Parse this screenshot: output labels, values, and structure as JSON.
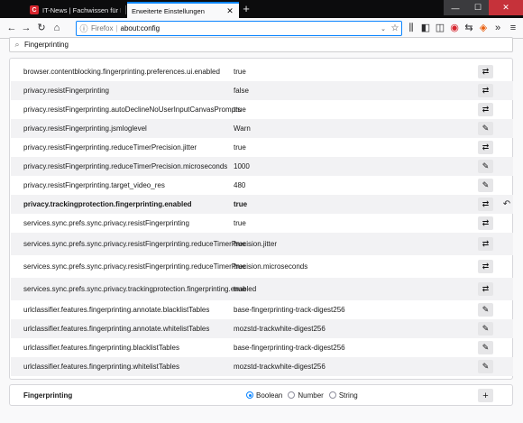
{
  "tabs": [
    {
      "favicon": "C",
      "title": "IT-News | Fachwissen für IT-Ex",
      "close": "✕"
    },
    {
      "title": "Erweiterte Einstellungen",
      "close": "✕"
    }
  ],
  "new_tab": "+",
  "window": {
    "minimize": "—",
    "maximize": "☐",
    "close": "✕"
  },
  "nav": {
    "back": "←",
    "forward": "→",
    "reload": "↻",
    "home": "⌂",
    "url_brand": "Firefox",
    "url_sep": "|",
    "url": "about:config",
    "dropdown": "⌄",
    "bookmark_star": "☆",
    "library": "⫼",
    "sidebar": "◧",
    "reader": "◫",
    "ext_red": "◉",
    "sync": "⇆",
    "ext_shield": "◈",
    "ext_key": "⚷",
    "overflow": "»",
    "menu": "≡"
  },
  "search": {
    "value": "Fingerprinting",
    "icon": "⌕"
  },
  "prefs": [
    {
      "name": "browser.contentblocking.fingerprinting.preferences.ui.enabled",
      "value": "true",
      "action": "toggle-icon",
      "glyph": "⇄",
      "modified": false
    },
    {
      "name": "privacy.resistFingerprinting",
      "value": "false",
      "action": "toggle-icon",
      "glyph": "⇄",
      "modified": false
    },
    {
      "name": "privacy.resistFingerprinting.autoDeclineNoUserInputCanvasPrompts",
      "value": "true",
      "action": "toggle-icon",
      "glyph": "⇄",
      "modified": false
    },
    {
      "name": "privacy.resistFingerprinting.jsmloglevel",
      "value": "Warn",
      "action": "edit-icon",
      "glyph": "✎",
      "modified": false
    },
    {
      "name": "privacy.resistFingerprinting.reduceTimerPrecision.jitter",
      "value": "true",
      "action": "toggle-icon",
      "glyph": "⇄",
      "modified": false
    },
    {
      "name": "privacy.resistFingerprinting.reduceTimerPrecision.microseconds",
      "value": "1000",
      "action": "edit-icon",
      "glyph": "✎",
      "modified": false
    },
    {
      "name": "privacy.resistFingerprinting.target_video_res",
      "value": "480",
      "action": "edit-icon",
      "glyph": "✎",
      "modified": false
    },
    {
      "name": "privacy.trackingprotection.fingerprinting.enabled",
      "value": "true",
      "action": "toggle-icon",
      "glyph": "⇄",
      "modified": true,
      "reset": "↶"
    },
    {
      "name": "services.sync.prefs.sync.privacy.resistFingerprinting",
      "value": "true",
      "action": "toggle-icon",
      "glyph": "⇄",
      "modified": false
    },
    {
      "name": "services.sync.prefs.sync.privacy.resistFingerprinting.reduceTimerPrecision.jitter",
      "value": "true",
      "action": "toggle-icon",
      "glyph": "⇄",
      "modified": false
    },
    {
      "name": "services.sync.prefs.sync.privacy.resistFingerprinting.reduceTimerPrecision.microseconds",
      "value": "true",
      "action": "toggle-icon",
      "glyph": "⇄",
      "modified": false
    },
    {
      "name": "services.sync.prefs.sync.privacy.trackingprotection.fingerprinting.enabled",
      "value": "true",
      "action": "toggle-icon",
      "glyph": "⇄",
      "modified": false
    },
    {
      "name": "urlclassifier.features.fingerprinting.annotate.blacklistTables",
      "value": "base-fingerprinting-track-digest256",
      "action": "edit-icon",
      "glyph": "✎",
      "modified": false
    },
    {
      "name": "urlclassifier.features.fingerprinting.annotate.whitelistTables",
      "value": "mozstd-trackwhite-digest256",
      "action": "edit-icon",
      "glyph": "✎",
      "modified": false
    },
    {
      "name": "urlclassifier.features.fingerprinting.blacklistTables",
      "value": "base-fingerprinting-track-digest256",
      "action": "edit-icon",
      "glyph": "✎",
      "modified": false
    },
    {
      "name": "urlclassifier.features.fingerprinting.whitelistTables",
      "value": "mozstd-trackwhite-digest256",
      "action": "edit-icon",
      "glyph": "✎",
      "modified": false
    }
  ],
  "add": {
    "name": "Fingerprinting",
    "types": [
      {
        "label": "Boolean",
        "selected": true
      },
      {
        "label": "Number",
        "selected": false
      },
      {
        "label": "String",
        "selected": false
      }
    ],
    "button": "+"
  },
  "colors": {
    "accent": "#0a84ff",
    "close_red": "#c6323a",
    "tabbar": "#0c0c0d"
  }
}
